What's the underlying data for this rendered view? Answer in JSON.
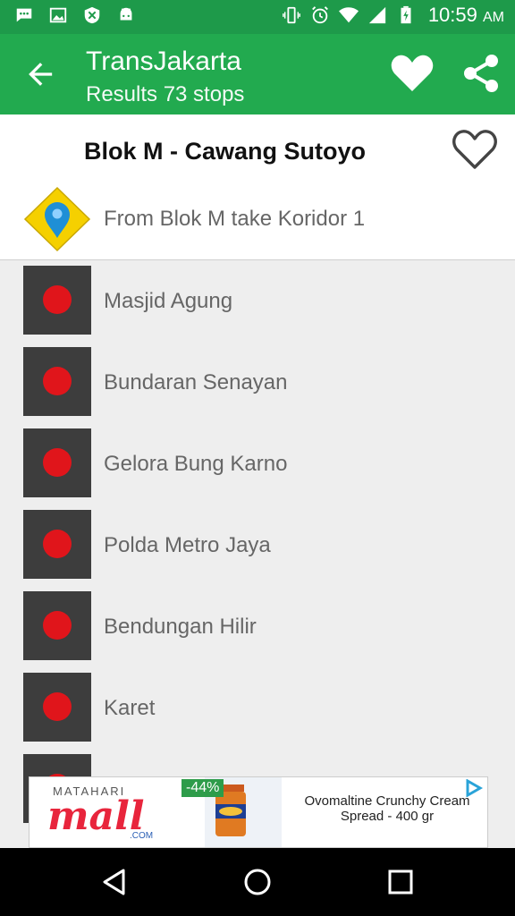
{
  "status_bar": {
    "time": "10:59",
    "ampm": "AM",
    "icons_left": [
      "message-icon",
      "image-icon",
      "shield-x-icon",
      "android-icon"
    ],
    "icons_right": [
      "vibrate-icon",
      "alarm-icon",
      "wifi-icon",
      "signal-icon",
      "battery-icon"
    ]
  },
  "app_bar": {
    "title": "TransJakarta",
    "subtitle": "Results 73 stops",
    "back_icon": "arrow-left-icon",
    "favorite_icon": "heart-filled-icon",
    "share_icon": "share-icon"
  },
  "route": {
    "title": "Blok M - Cawang Sutoyo",
    "favorite_icon": "heart-outline-icon"
  },
  "from_row": {
    "label": "From Blok M take Koridor 1",
    "icon": "map-marker-icon"
  },
  "stops": [
    {
      "name": "Masjid Agung"
    },
    {
      "name": "Bundaran Senayan"
    },
    {
      "name": "Gelora Bung Karno"
    },
    {
      "name": "Polda Metro Jaya"
    },
    {
      "name": "Bendungan Hilir"
    },
    {
      "name": "Karet"
    }
  ],
  "ad": {
    "brand_top": "MATAHARI",
    "brand_main": "mall",
    "brand_sub": ".COM",
    "discount": "-44%",
    "product_text": "Ovomaltine Crunchy Cream Spread - 400 gr"
  },
  "colors": {
    "status_bar": "#1e9a4a",
    "app_bar": "#22aa4f",
    "stop_square": "#3d3d3d",
    "stop_dot": "#e0151b"
  }
}
